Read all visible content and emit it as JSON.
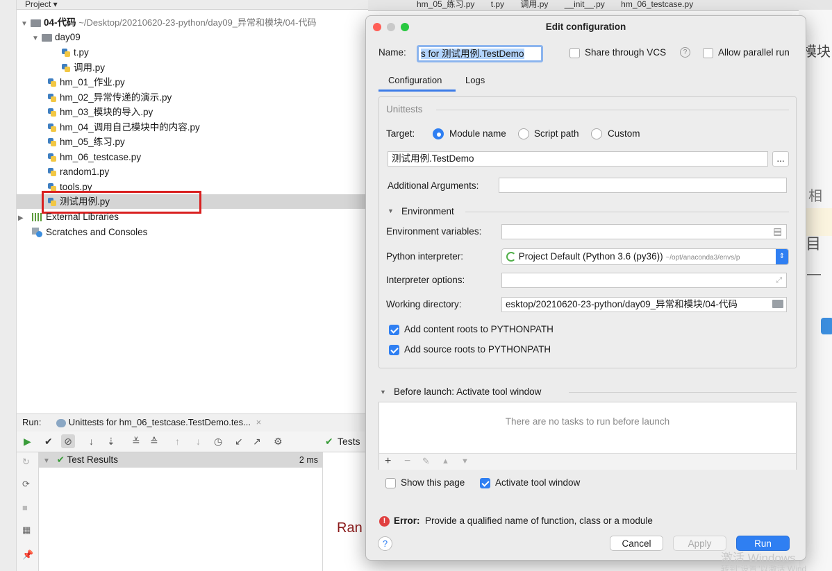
{
  "project_tree": {
    "header_label": "Project ▾",
    "root": {
      "name": "04-代码",
      "path": "~/Desktop/20210620-23-python/day09_异常和模块/04-代码"
    },
    "day09_folder": "day09",
    "day09_files": [
      "t.py",
      "调用.py"
    ],
    "files": [
      "hm_01_作业.py",
      "hm_02_异常传递的演示.py",
      "hm_03_模块的导入.py",
      "hm_04_调用自己模块中的内容.py",
      "hm_05_练习.py",
      "hm_06_testcase.py",
      "random1.py",
      "tools.py",
      "测试用例.py"
    ],
    "external_libraries": "External Libraries",
    "scratches": "Scratches and Consoles"
  },
  "editor_tabs": [
    "hm_05_练习.py",
    "t.py",
    "调用.py",
    "__init__.py",
    "hm_06_testcase.py"
  ],
  "run_panel": {
    "label": "Run:",
    "config_name": "Unittests for hm_06_testcase.TestDemo.tes...",
    "test_results": "Test Results",
    "test_results_time": "2 ms",
    "tests_label": "Tests",
    "right_text": "Ran"
  },
  "background_fragments": {
    "top": "模块",
    "mid1": "相",
    "mid2": "目",
    "dash": "—"
  },
  "dialog": {
    "title": "Edit configuration",
    "name_label": "Name:",
    "name_value": "s for 测试用例.TestDemo",
    "share_vcs": "Share through VCS",
    "help_icon": "?",
    "allow_parallel": "Allow parallel run",
    "tabs": [
      "Configuration",
      "Logs"
    ],
    "group_title": "Unittests",
    "target_label": "Target:",
    "target_options": [
      "Module name",
      "Script path",
      "Custom"
    ],
    "target_value": "测试用例.TestDemo",
    "ellipsis_button": "...",
    "additional_args_label": "Additional Arguments:",
    "environment_section": "Environment",
    "env_vars_label": "Environment variables:",
    "python_interpreter_label": "Python interpreter:",
    "python_interpreter_value": "Project Default (Python 3.6 (py36))",
    "python_interpreter_path": "~/opt/anaconda3/envs/p",
    "interpreter_options_label": "Interpreter options:",
    "working_dir_label": "Working directory:",
    "working_dir_value": "esktop/20210620-23-python/day09_异常和模块/04-代码",
    "add_content_roots": "Add content roots to PYTHONPATH",
    "add_source_roots": "Add source roots to PYTHONPATH",
    "before_launch": "Before launch: Activate tool window",
    "no_tasks": "There are no tasks to run before launch",
    "show_page": "Show this page",
    "activate_tool": "Activate tool window",
    "error_prefix": "Error:",
    "error_text": "Provide a qualified name of function, class or a module",
    "cancel": "Cancel",
    "apply": "Apply",
    "run": "Run"
  },
  "watermark": {
    "line1": "激活 Windows",
    "line2": "转到\"设置\"以激活 Wind"
  },
  "colors": {
    "accent": "#2f7ff2",
    "error": "#e04040",
    "selection_box": "#d92020"
  }
}
